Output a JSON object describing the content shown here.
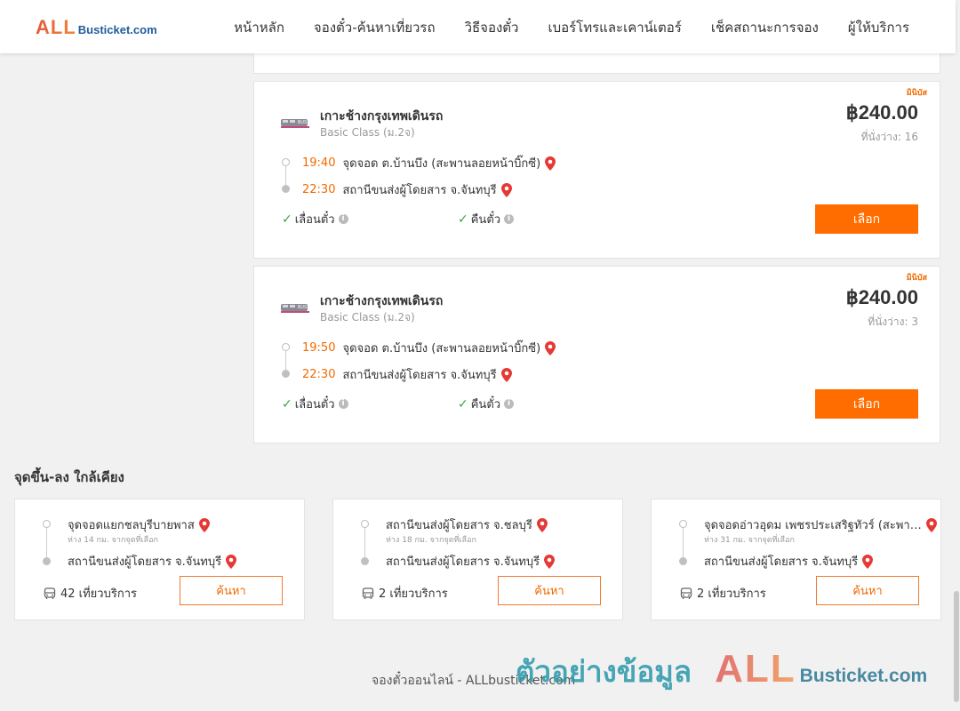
{
  "header": {
    "logo_all": "ALL",
    "logo_rest": "Busticket.com",
    "nav": [
      "หน้าหลัก",
      "จองตั๋ว-ค้นหาเที่ยวรถ",
      "วิธีจองตั๋ว",
      "เบอร์โทรและเคาน์เตอร์",
      "เช็คสถานะการจอง",
      "ผู้ให้บริการ"
    ]
  },
  "trips": [
    {
      "badge": "มินิบัส",
      "operator": "เกาะช้างกรุงเทพเดินรถ",
      "class": "Basic Class (ม.2จ)",
      "price": "฿240.00",
      "seats": "ที่นั่งว่าง: 16",
      "depart_time": "19:40",
      "depart_place": "จุดจอด ต.บ้านบึง (สะพานลอยหน้าบิ๊กซี)",
      "arrive_time": "22:30",
      "arrive_place": "สถานีขนส่งผู้โดยสาร จ.จันทบุรี",
      "feature_1": "เลื่อนตั๋ว",
      "feature_2": "คืนตั๋ว",
      "button": "เลือก"
    },
    {
      "badge": "มินิบัส",
      "operator": "เกาะช้างกรุงเทพเดินรถ",
      "class": "Basic Class (ม.2จ)",
      "price": "฿240.00",
      "seats": "ที่นั่งว่าง: 3",
      "depart_time": "19:50",
      "depart_place": "จุดจอด ต.บ้านบึง (สะพานลอยหน้าบิ๊กซี)",
      "arrive_time": "22:30",
      "arrive_place": "สถานีขนส่งผู้โดยสาร จ.จันทบุรี",
      "feature_1": "เลื่อนตั๋ว",
      "feature_2": "คืนตั๋ว",
      "button": "เลือก"
    }
  ],
  "nearby": {
    "title": "จุดขึ้น-ลง ใกล้เคียง",
    "items": [
      {
        "from": "จุดจอดแยกชลบุรีบายพาส",
        "distance": "ห่าง 14 กม. จากจุดที่เลือก",
        "to": "สถานีขนส่งผู้โดยสาร จ.จันทบุรี",
        "trips": "42 เที่ยวบริการ",
        "button": "ค้นหา"
      },
      {
        "from": "สถานีขนส่งผู้โดยสาร จ.ชลบุรี",
        "distance": "ห่าง 18 กม. จากจุดที่เลือก",
        "to": "สถานีขนส่งผู้โดยสาร จ.จันทบุรี",
        "trips": "2 เที่ยวบริการ",
        "button": "ค้นหา"
      },
      {
        "from": "จุดจอดอ่าวอุดม เพชรประเสริฐทัวร์ (สะพานลอย...",
        "distance": "ห่าง 31 กม. จากจุดที่เลือก",
        "to": "สถานีขนส่งผู้โดยสาร จ.จันทบุรี",
        "trips": "2 เที่ยวบริการ",
        "button": "ค้นหา"
      }
    ]
  },
  "footer": {
    "text": "จองตั๋วออนไลน์ - ALLbusticket.com"
  },
  "watermark": {
    "thai": "ตัวอย่างข้อมูล",
    "all": "ALL",
    "rest": "Busticket.com"
  },
  "colors": {
    "accent": "#ff6d00",
    "time": "#f06a00",
    "check": "#3aa63a",
    "pin": "#e53935"
  }
}
